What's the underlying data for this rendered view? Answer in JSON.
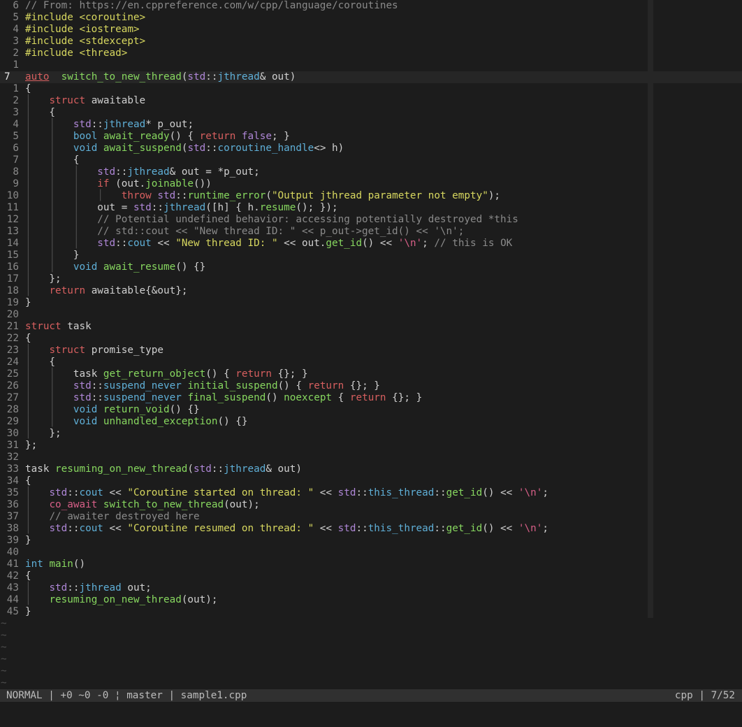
{
  "editor": {
    "lines": [
      {
        "num": "6",
        "toks": [
          [
            "c",
            "// From: https://en.cppreference.com/w/cpp/language/coroutines"
          ]
        ]
      },
      {
        "num": "5",
        "toks": [
          [
            "s",
            "#include <coroutine>"
          ]
        ]
      },
      {
        "num": "4",
        "toks": [
          [
            "s",
            "#include <iostream>"
          ]
        ]
      },
      {
        "num": "3",
        "toks": [
          [
            "s",
            "#include <stdexcept>"
          ]
        ]
      },
      {
        "num": "2",
        "toks": [
          [
            "s",
            "#include <thread>"
          ]
        ]
      },
      {
        "num": "1",
        "toks": []
      },
      {
        "num": "7",
        "current": true,
        "toks": [
          [
            "k",
            "auto"
          ],
          [
            "",
            "  "
          ],
          [
            "f",
            "switch_to_new_thread"
          ],
          [
            "",
            "("
          ],
          [
            "p",
            "std"
          ],
          [
            "",
            "::"
          ],
          [
            "t",
            "jthread"
          ],
          [
            "",
            "& out)"
          ]
        ]
      },
      {
        "num": "1",
        "toks": [
          [
            "",
            "{"
          ]
        ]
      },
      {
        "num": "2",
        "toks": [
          [
            "g",
            "│"
          ],
          [
            "",
            "   "
          ],
          [
            "k",
            "struct"
          ],
          [
            "",
            " awaitable"
          ]
        ]
      },
      {
        "num": "3",
        "toks": [
          [
            "g",
            "│"
          ],
          [
            "",
            "   {"
          ]
        ]
      },
      {
        "num": "4",
        "toks": [
          [
            "g",
            "│   │"
          ],
          [
            "",
            "   "
          ],
          [
            "p",
            "std"
          ],
          [
            "",
            "::"
          ],
          [
            "t",
            "jthread"
          ],
          [
            "",
            "* p_out;"
          ]
        ]
      },
      {
        "num": "5",
        "toks": [
          [
            "g",
            "│   │"
          ],
          [
            "",
            "   "
          ],
          [
            "t",
            "bool"
          ],
          [
            "",
            " "
          ],
          [
            "f",
            "await_ready"
          ],
          [
            "",
            "() { "
          ],
          [
            "k",
            "return"
          ],
          [
            "",
            " "
          ],
          [
            "p",
            "false"
          ],
          [
            "",
            "; }"
          ]
        ]
      },
      {
        "num": "6",
        "toks": [
          [
            "g",
            "│   │"
          ],
          [
            "",
            "   "
          ],
          [
            "t",
            "void"
          ],
          [
            "",
            " "
          ],
          [
            "f",
            "await_suspend"
          ],
          [
            "",
            "("
          ],
          [
            "p",
            "std"
          ],
          [
            "",
            "::"
          ],
          [
            "t",
            "coroutine_handle"
          ],
          [
            "",
            "<> h)"
          ]
        ]
      },
      {
        "num": "7",
        "toks": [
          [
            "g",
            "│   │"
          ],
          [
            "",
            "   {"
          ]
        ]
      },
      {
        "num": "8",
        "toks": [
          [
            "g",
            "│   │   │"
          ],
          [
            "",
            "   "
          ],
          [
            "p",
            "std"
          ],
          [
            "",
            "::"
          ],
          [
            "t",
            "jthread"
          ],
          [
            "",
            "& out = *p_out;"
          ]
        ]
      },
      {
        "num": "9",
        "toks": [
          [
            "g",
            "│   │   │"
          ],
          [
            "",
            "   "
          ],
          [
            "k",
            "if"
          ],
          [
            "",
            " (out."
          ],
          [
            "f",
            "joinable"
          ],
          [
            "",
            "())"
          ]
        ]
      },
      {
        "num": "10",
        "toks": [
          [
            "g",
            "│   │   │   │"
          ],
          [
            "",
            "   "
          ],
          [
            "k",
            "throw"
          ],
          [
            "",
            " "
          ],
          [
            "p",
            "std"
          ],
          [
            "",
            "::"
          ],
          [
            "f",
            "runtime_error"
          ],
          [
            "",
            "("
          ],
          [
            "s",
            "\"Output jthread parameter not empty\""
          ],
          [
            "",
            ");"
          ]
        ]
      },
      {
        "num": "11",
        "toks": [
          [
            "g",
            "│   │   │"
          ],
          [
            "",
            "   out = "
          ],
          [
            "p",
            "std"
          ],
          [
            "",
            "::"
          ],
          [
            "t",
            "jthread"
          ],
          [
            "",
            "([h] { h."
          ],
          [
            "f",
            "resume"
          ],
          [
            "",
            "(); });"
          ]
        ]
      },
      {
        "num": "12",
        "toks": [
          [
            "g",
            "│   │   │"
          ],
          [
            "",
            "   "
          ],
          [
            "c",
            "// Potential undefined behavior: accessing potentially destroyed *this"
          ]
        ]
      },
      {
        "num": "13",
        "toks": [
          [
            "g",
            "│   │   │"
          ],
          [
            "",
            "   "
          ],
          [
            "c",
            "// std::cout << \"New thread ID: \" << p_out->get_id() << '\\n';"
          ]
        ]
      },
      {
        "num": "14",
        "toks": [
          [
            "g",
            "│   │   │"
          ],
          [
            "",
            "   "
          ],
          [
            "p",
            "std"
          ],
          [
            "",
            "::"
          ],
          [
            "t",
            "cout"
          ],
          [
            "",
            " << "
          ],
          [
            "s",
            "\"New thread ID: \""
          ],
          [
            "",
            " << out."
          ],
          [
            "f",
            "get_id"
          ],
          [
            "",
            "() << "
          ],
          [
            "cr",
            "'\\n'"
          ],
          [
            "",
            "; "
          ],
          [
            "c",
            "// this is OK"
          ]
        ]
      },
      {
        "num": "15",
        "toks": [
          [
            "g",
            "│   │"
          ],
          [
            "",
            "   }"
          ]
        ]
      },
      {
        "num": "16",
        "toks": [
          [
            "g",
            "│   │"
          ],
          [
            "",
            "   "
          ],
          [
            "t",
            "void"
          ],
          [
            "",
            " "
          ],
          [
            "f",
            "await_resume"
          ],
          [
            "",
            "() {}"
          ]
        ]
      },
      {
        "num": "17",
        "toks": [
          [
            "g",
            "│"
          ],
          [
            "",
            "   };"
          ]
        ]
      },
      {
        "num": "18",
        "toks": [
          [
            "g",
            "│"
          ],
          [
            "",
            "   "
          ],
          [
            "k",
            "return"
          ],
          [
            "",
            " awaitable{&out};"
          ]
        ]
      },
      {
        "num": "19",
        "toks": [
          [
            "",
            "}"
          ]
        ]
      },
      {
        "num": "20",
        "toks": []
      },
      {
        "num": "21",
        "toks": [
          [
            "k",
            "struct"
          ],
          [
            "",
            " task"
          ]
        ]
      },
      {
        "num": "22",
        "toks": [
          [
            "",
            "{"
          ]
        ]
      },
      {
        "num": "23",
        "toks": [
          [
            "g",
            "│"
          ],
          [
            "",
            "   "
          ],
          [
            "k",
            "struct"
          ],
          [
            "",
            " promise_type"
          ]
        ]
      },
      {
        "num": "24",
        "toks": [
          [
            "g",
            "│"
          ],
          [
            "",
            "   {"
          ]
        ]
      },
      {
        "num": "25",
        "toks": [
          [
            "g",
            "│   │"
          ],
          [
            "",
            "   task "
          ],
          [
            "f",
            "get_return_object"
          ],
          [
            "",
            "() { "
          ],
          [
            "k",
            "return"
          ],
          [
            "",
            " {}; }"
          ]
        ]
      },
      {
        "num": "26",
        "toks": [
          [
            "g",
            "│   │"
          ],
          [
            "",
            "   "
          ],
          [
            "p",
            "std"
          ],
          [
            "",
            "::"
          ],
          [
            "t",
            "suspend_never"
          ],
          [
            "",
            " "
          ],
          [
            "f",
            "initial_suspend"
          ],
          [
            "",
            "() { "
          ],
          [
            "k",
            "return"
          ],
          [
            "",
            " {}; }"
          ]
        ]
      },
      {
        "num": "27",
        "toks": [
          [
            "g",
            "│   │"
          ],
          [
            "",
            "   "
          ],
          [
            "p",
            "std"
          ],
          [
            "",
            "::"
          ],
          [
            "t",
            "suspend_never"
          ],
          [
            "",
            " "
          ],
          [
            "f",
            "final_suspend"
          ],
          [
            "",
            "() "
          ],
          [
            "f",
            "noexcept"
          ],
          [
            "",
            " { "
          ],
          [
            "k",
            "return"
          ],
          [
            "",
            " {}; }"
          ]
        ]
      },
      {
        "num": "28",
        "toks": [
          [
            "g",
            "│   │"
          ],
          [
            "",
            "   "
          ],
          [
            "t",
            "void"
          ],
          [
            "",
            " "
          ],
          [
            "f",
            "return_void"
          ],
          [
            "",
            "() {}"
          ]
        ]
      },
      {
        "num": "29",
        "toks": [
          [
            "g",
            "│   │"
          ],
          [
            "",
            "   "
          ],
          [
            "t",
            "void"
          ],
          [
            "",
            " "
          ],
          [
            "f",
            "unhandled_exception"
          ],
          [
            "",
            "() {}"
          ]
        ]
      },
      {
        "num": "30",
        "toks": [
          [
            "g",
            "│"
          ],
          [
            "",
            "   };"
          ]
        ]
      },
      {
        "num": "31",
        "toks": [
          [
            "",
            "};"
          ]
        ]
      },
      {
        "num": "32",
        "toks": []
      },
      {
        "num": "33",
        "toks": [
          [
            "",
            "task "
          ],
          [
            "f",
            "resuming_on_new_thread"
          ],
          [
            "",
            "("
          ],
          [
            "p",
            "std"
          ],
          [
            "",
            "::"
          ],
          [
            "t",
            "jthread"
          ],
          [
            "",
            "& out)"
          ]
        ]
      },
      {
        "num": "34",
        "toks": [
          [
            "",
            "{"
          ]
        ]
      },
      {
        "num": "35",
        "toks": [
          [
            "g",
            "│"
          ],
          [
            "",
            "   "
          ],
          [
            "p",
            "std"
          ],
          [
            "",
            "::"
          ],
          [
            "t",
            "cout"
          ],
          [
            "",
            " << "
          ],
          [
            "s",
            "\"Coroutine started on thread: \""
          ],
          [
            "",
            " << "
          ],
          [
            "p",
            "std"
          ],
          [
            "",
            "::"
          ],
          [
            "t",
            "this_thread"
          ],
          [
            "",
            "::"
          ],
          [
            "f",
            "get_id"
          ],
          [
            "",
            "() << "
          ],
          [
            "cr",
            "'\\n'"
          ],
          [
            "",
            ";"
          ]
        ]
      },
      {
        "num": "36",
        "toks": [
          [
            "g",
            "│"
          ],
          [
            "",
            "   "
          ],
          [
            "cr",
            "co_await"
          ],
          [
            "",
            " "
          ],
          [
            "f",
            "switch_to_new_thread"
          ],
          [
            "",
            "(out);"
          ]
        ]
      },
      {
        "num": "37",
        "toks": [
          [
            "g",
            "│"
          ],
          [
            "",
            "   "
          ],
          [
            "c",
            "// awaiter destroyed here"
          ]
        ]
      },
      {
        "num": "38",
        "toks": [
          [
            "g",
            "│"
          ],
          [
            "",
            "   "
          ],
          [
            "p",
            "std"
          ],
          [
            "",
            "::"
          ],
          [
            "t",
            "cout"
          ],
          [
            "",
            " << "
          ],
          [
            "s",
            "\"Coroutine resumed on thread: \""
          ],
          [
            "",
            " << "
          ],
          [
            "p",
            "std"
          ],
          [
            "",
            "::"
          ],
          [
            "t",
            "this_thread"
          ],
          [
            "",
            "::"
          ],
          [
            "f",
            "get_id"
          ],
          [
            "",
            "() << "
          ],
          [
            "cr",
            "'\\n'"
          ],
          [
            "",
            ";"
          ]
        ]
      },
      {
        "num": "39",
        "toks": [
          [
            "",
            "}"
          ]
        ]
      },
      {
        "num": "40",
        "toks": []
      },
      {
        "num": "41",
        "toks": [
          [
            "t",
            "int"
          ],
          [
            "",
            " "
          ],
          [
            "f",
            "main"
          ],
          [
            "",
            "()"
          ]
        ]
      },
      {
        "num": "42",
        "toks": [
          [
            "",
            "{"
          ]
        ]
      },
      {
        "num": "43",
        "toks": [
          [
            "g",
            "│"
          ],
          [
            "",
            "   "
          ],
          [
            "p",
            "std"
          ],
          [
            "",
            "::"
          ],
          [
            "t",
            "jthread"
          ],
          [
            "",
            " out;"
          ]
        ]
      },
      {
        "num": "44",
        "toks": [
          [
            "g",
            "│"
          ],
          [
            "",
            "   "
          ],
          [
            "f",
            "resuming_on_new_thread"
          ],
          [
            "",
            "(out);"
          ]
        ]
      },
      {
        "num": "45",
        "toks": [
          [
            "",
            "}"
          ]
        ]
      }
    ],
    "tildes": [
      "~",
      "~",
      "~",
      "~",
      "~",
      "~"
    ]
  },
  "statusbar": {
    "mode": "NORMAL",
    "git_diff": "+0 ~0 -0",
    "branch_sep": "¦",
    "branch": "master",
    "filename": "sample1.cpp",
    "filetype": "cpp",
    "position": "7/52",
    "sep": "|"
  }
}
